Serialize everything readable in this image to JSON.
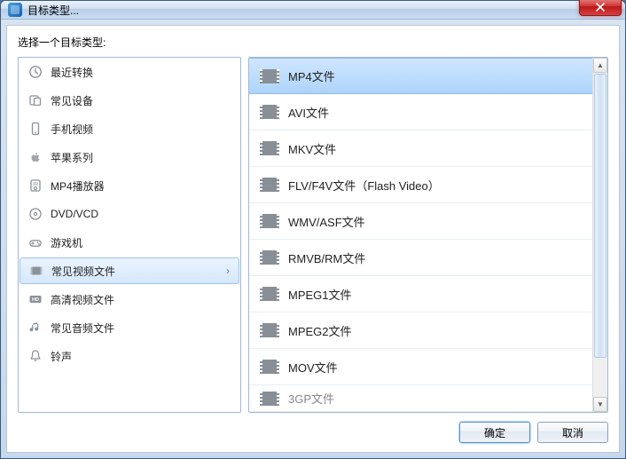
{
  "window": {
    "title": "目标类型..."
  },
  "prompt": "选择一个目标类型:",
  "categories": {
    "items": [
      {
        "label": "最近转换",
        "icon": "clock-icon"
      },
      {
        "label": "常见设备",
        "icon": "device-icon"
      },
      {
        "label": "手机视频",
        "icon": "phone-icon"
      },
      {
        "label": "苹果系列",
        "icon": "apple-icon"
      },
      {
        "label": "MP4播放器",
        "icon": "player-icon"
      },
      {
        "label": "DVD/VCD",
        "icon": "disc-icon"
      },
      {
        "label": "游戏机",
        "icon": "gamepad-icon"
      },
      {
        "label": "常见视频文件",
        "icon": "video-icon",
        "selected": true
      },
      {
        "label": "高清视频文件",
        "icon": "hd-icon"
      },
      {
        "label": "常见音频文件",
        "icon": "audio-icon"
      },
      {
        "label": "铃声",
        "icon": "bell-icon"
      }
    ]
  },
  "formats": {
    "items": [
      {
        "label": "MP4文件",
        "selected": true
      },
      {
        "label": "AVI文件"
      },
      {
        "label": "MKV文件"
      },
      {
        "label": "FLV/F4V文件（Flash Video）"
      },
      {
        "label": "WMV/ASF文件"
      },
      {
        "label": "RMVB/RM文件"
      },
      {
        "label": "MPEG1文件"
      },
      {
        "label": "MPEG2文件"
      },
      {
        "label": "MOV文件"
      },
      {
        "label": "3GP文件"
      }
    ]
  },
  "buttons": {
    "ok": "确定",
    "cancel": "取消"
  },
  "chevron": "›"
}
